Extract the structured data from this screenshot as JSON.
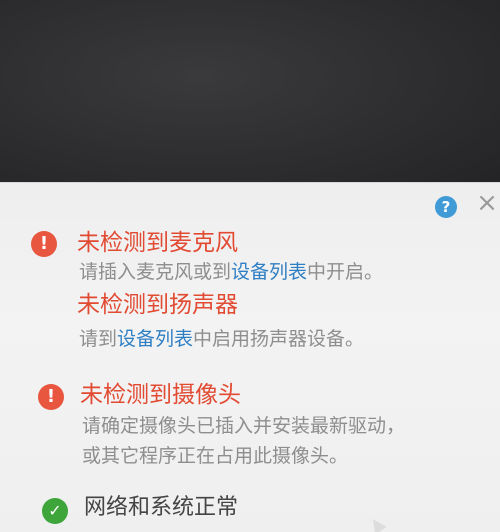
{
  "dialog": {
    "help_icon_glyph": "?",
    "close_icon_glyph": "×"
  },
  "alerts": [
    {
      "icon_glyph": "!",
      "title": "未检测到麦克风",
      "desc_parts": [
        "请插入麦克风或到",
        "设备列表",
        "中开启。"
      ]
    },
    {
      "title": "未检测到扬声器",
      "desc_parts": [
        "请到",
        "设备列表",
        "中启用扬声器设备。"
      ]
    },
    {
      "icon_glyph": "!",
      "title": "未检测到摄像头",
      "desc_line1": "请确定摄像头已插入并安装最新驱动，",
      "desc_line2": "或其它程序正在占用此摄像头。"
    }
  ],
  "network_status": {
    "icon_glyph": "✓",
    "label": "网络和系统正常"
  },
  "colors": {
    "error_red": "#e24a32",
    "link_blue": "#2f7fc4",
    "ok_green": "#3ea53a",
    "help_blue": "#3f9ad6"
  }
}
